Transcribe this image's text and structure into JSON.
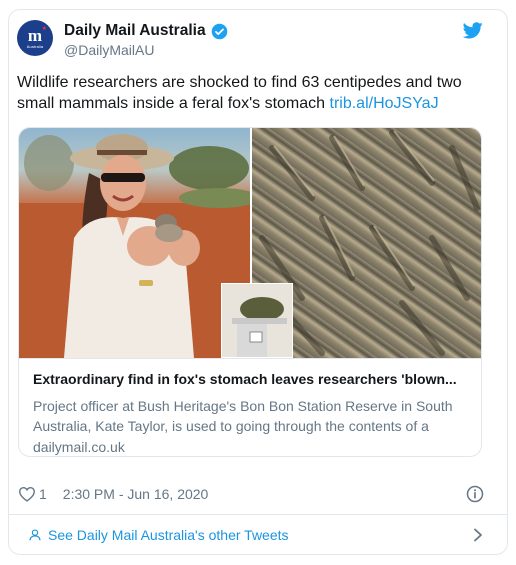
{
  "account": {
    "display_name": "Daily Mail Australia",
    "handle": "@DailyMailAU",
    "avatar_text": "m",
    "avatar_sub": "Australia"
  },
  "tweet": {
    "text": "Wildlife researchers are shocked to find 63 centipedes and two small mammals inside a feral fox's stomach",
    "link_text": "trib.al/HoJSYaJ"
  },
  "card": {
    "title": "Extraordinary find in fox's stomach leaves researchers 'blown...",
    "description": "Project officer at Bush Heritage's Bon Bon Station Reserve in South Australia, Kate Taylor, is used to going through the contents of a",
    "domain": "dailymail.co.uk"
  },
  "meta": {
    "like_count": "1",
    "timestamp": "2:30 PM - Jun 16, 2020"
  },
  "footer": {
    "label": "See Daily Mail Australia's other Tweets"
  },
  "colors": {
    "accent": "#1b95e0",
    "verified": "#1da1f2",
    "secondary_text": "#657786",
    "border": "#e1e8ed"
  },
  "icons": [
    "verified-badge-icon",
    "twitter-bird-icon",
    "heart-icon",
    "info-icon",
    "person-icon",
    "chevron-right-icon"
  ]
}
